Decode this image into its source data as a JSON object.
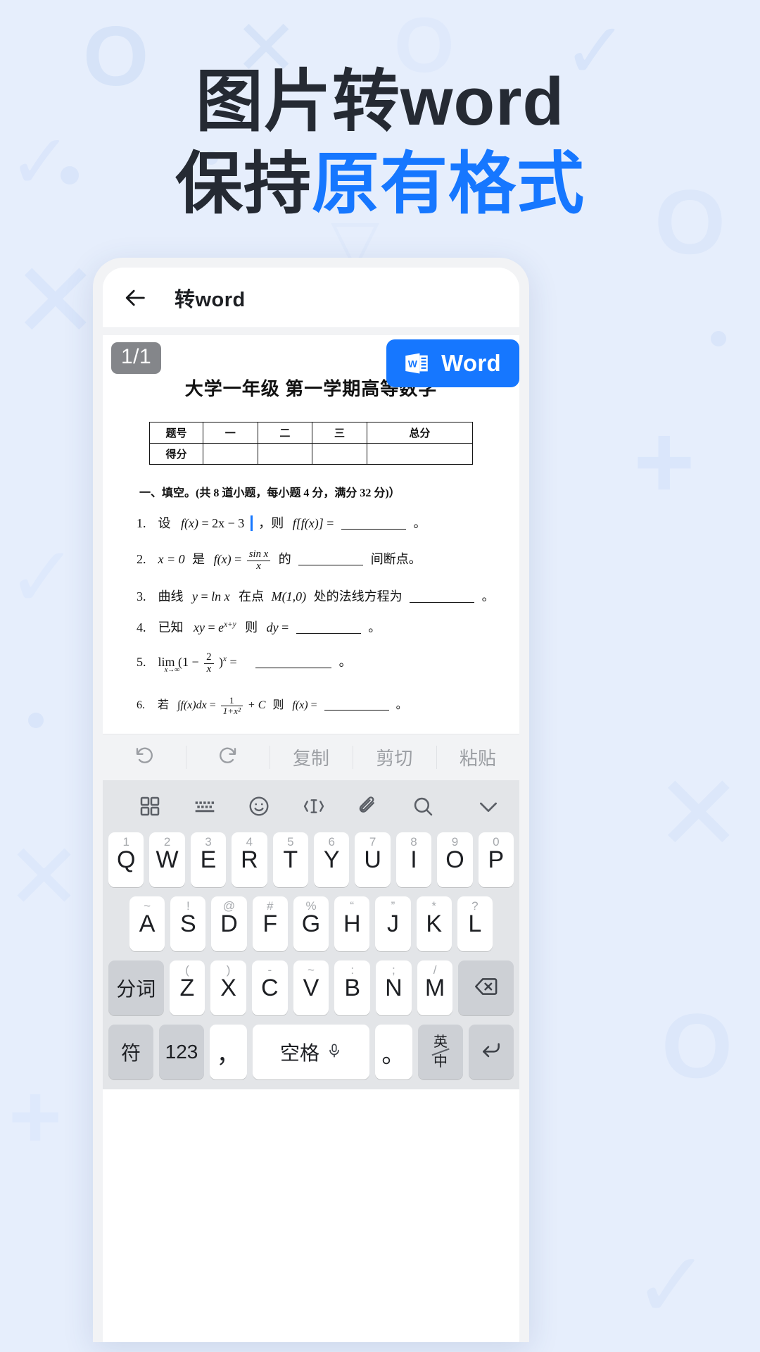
{
  "headline": {
    "line1": "图片转word",
    "line2_dark": "保持",
    "line2_accent": "原有格式",
    "accent_color": "#1677ff",
    "dark_color": "#252a33"
  },
  "appbar": {
    "back_icon": "back-arrow-icon",
    "title": "转word"
  },
  "document": {
    "page_badge": "1/1",
    "word_button": {
      "label": "Word",
      "icon": "word-logo-icon",
      "color": "#1677ff"
    },
    "title": "大学一年级 第一学期高等数学",
    "score_table": {
      "row_headers": [
        "题号",
        "得分"
      ],
      "columns": [
        "一",
        "二",
        "三",
        "总分"
      ],
      "scores": [
        "",
        "",
        "",
        ""
      ]
    },
    "section_heading": "一、填空。(共 8 道小题，每小题 4 分，满分 32 分)）",
    "questions": [
      {
        "num": "1.",
        "text": "设  f(x) = 2x − 3 ，则 f[f(x)] = ________ 。"
      },
      {
        "num": "2.",
        "text": "x = 0 是 f(x) = sin x / x 的 ________ 间断点。"
      },
      {
        "num": "3.",
        "text": "曲线 y = ln x 在点 M(1,0) 处的法线方程为 ________ 。"
      },
      {
        "num": "4.",
        "text": "已知 xy = e^(x+y) 则 dy = ________ 。"
      },
      {
        "num": "5.",
        "text": "lim(x→∞)(1 − 2/x)^x = ________ 。"
      },
      {
        "num": "6.",
        "text": "若 ∫f(x)dx = 1/(1+x²) + C 则 f(x) = ________ 。"
      }
    ],
    "question_labels": {
      "q1": {
        "prefix": "设",
        "fx": "f(x)",
        "eq": "= 2x",
        "minus": "− 3",
        "then": "，则",
        "ffx": "f[f(x)]",
        "equals": "=",
        "period": "。"
      },
      "q2": {
        "x0": "x = 0",
        "shi": "是",
        "fx": "f(x)",
        "eq": "=",
        "num": "sin x",
        "den": "x",
        "de": "的",
        "tail": "间断点。"
      },
      "q3": {
        "curve": "曲线",
        "y": "y",
        "eq": "=",
        "ln": "ln x",
        "at": "在点",
        "point": "M(1,0)",
        "rest": "处的法线方程为",
        "period": "。"
      },
      "q4": {
        "known": "已知",
        "xy": "xy",
        "eq": "=",
        "e": "e",
        "exp": "x+y",
        "then": "则",
        "dy": "dy",
        "equals": "=",
        "period": "。"
      },
      "q5": {
        "lim": "lim",
        "sub": "x→∞",
        "open": "(1 −",
        "num": "2",
        "den": "x",
        "close": ")",
        "exp": "x",
        "equals": "=",
        "period": "。"
      },
      "q6": {
        "ruo": "若",
        "integral": "∫f(x)dx",
        "eq": "=",
        "num": "1",
        "den": "1+x²",
        "plusc": "+ C",
        "then": "则",
        "fx": "f(x)",
        "equals": "=",
        "period": "。"
      }
    }
  },
  "edit_toolbar": {
    "items": [
      {
        "name": "undo",
        "label": "",
        "icon": "undo-icon"
      },
      {
        "name": "redo",
        "label": "",
        "icon": "redo-icon"
      },
      {
        "name": "copy",
        "label": "复制",
        "icon": ""
      },
      {
        "name": "cut",
        "label": "剪切",
        "icon": ""
      },
      {
        "name": "paste",
        "label": "粘贴",
        "icon": ""
      }
    ]
  },
  "keyboard": {
    "toolbar_icons": [
      "grid-icon",
      "keyboard-icon",
      "emoji-icon",
      "text-cursor-icon",
      "clipboard-icon",
      "search-icon",
      "chevron-down-icon"
    ],
    "row1": [
      {
        "sub": "1",
        "main": "Q"
      },
      {
        "sub": "2",
        "main": "W"
      },
      {
        "sub": "3",
        "main": "E"
      },
      {
        "sub": "4",
        "main": "R"
      },
      {
        "sub": "5",
        "main": "T"
      },
      {
        "sub": "6",
        "main": "Y"
      },
      {
        "sub": "7",
        "main": "U"
      },
      {
        "sub": "8",
        "main": "I"
      },
      {
        "sub": "9",
        "main": "O"
      },
      {
        "sub": "0",
        "main": "P"
      }
    ],
    "row2": [
      {
        "sub": "~",
        "main": "A"
      },
      {
        "sub": "!",
        "main": "S"
      },
      {
        "sub": "@",
        "main": "D"
      },
      {
        "sub": "#",
        "main": "F"
      },
      {
        "sub": "%",
        "main": "G"
      },
      {
        "sub": "“",
        "main": "H"
      },
      {
        "sub": "”",
        "main": "J"
      },
      {
        "sub": "*",
        "main": "K"
      },
      {
        "sub": "?",
        "main": "L"
      }
    ],
    "row3": [
      {
        "sub": "",
        "main": "分词",
        "type": "fn"
      },
      {
        "sub": "(",
        "main": "Z"
      },
      {
        "sub": ")",
        "main": "X"
      },
      {
        "sub": "-",
        "main": "C"
      },
      {
        "sub": "~",
        "main": "V"
      },
      {
        "sub": ":",
        "main": "B"
      },
      {
        "sub": ";",
        "main": "N"
      },
      {
        "sub": "/",
        "main": "M"
      },
      {
        "sub": "",
        "main": "",
        "type": "backspace"
      }
    ],
    "row4": {
      "symbol": "符",
      "numbers": "123",
      "comma": "，",
      "space": "空格",
      "period": "。",
      "lang_top": "英",
      "lang_bottom": "中",
      "enter": "enter-icon"
    }
  }
}
